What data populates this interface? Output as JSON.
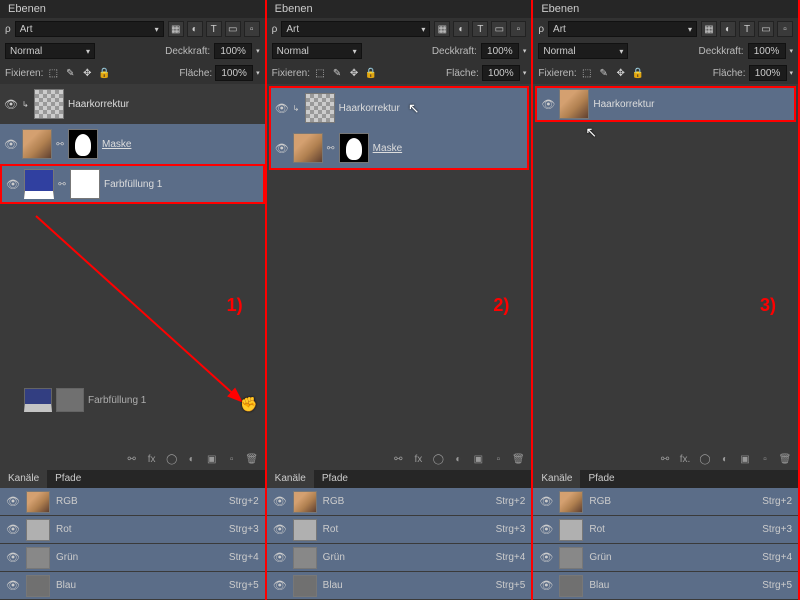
{
  "panel_title": "Ebenen",
  "search_type": "Art",
  "blend_mode": "Normal",
  "opacity_label": "Deckkraft:",
  "opacity_value": "100%",
  "lock_label": "Fixieren:",
  "fill_label": "Fläche:",
  "fill_value": "100%",
  "layers": {
    "haar": "Haarkorrektur",
    "maske": "Maske",
    "farb": "Farbfüllung 1"
  },
  "channels_title": "Kanäle",
  "paths_title": "Pfade",
  "channels": [
    {
      "name": "RGB",
      "shortcut": "Strg+2"
    },
    {
      "name": "Rot",
      "shortcut": "Strg+3"
    },
    {
      "name": "Grün",
      "shortcut": "Strg+4"
    },
    {
      "name": "Blau",
      "shortcut": "Strg+5"
    }
  ],
  "anno": {
    "one": "1)",
    "two": "2)",
    "three": "3)"
  },
  "icons": {
    "img": "▦",
    "fx": "fx",
    "mask": "◯",
    "adj": "◐",
    "folder": "▣",
    "new": "▫",
    "trash": "🗑",
    "link": "⚯",
    "t": "T",
    "shape": "▭",
    "filter": "▮",
    "lock": "🔒",
    "move": "✥",
    "brush": "✎",
    "trans": "⬚",
    "eye": "👁"
  }
}
